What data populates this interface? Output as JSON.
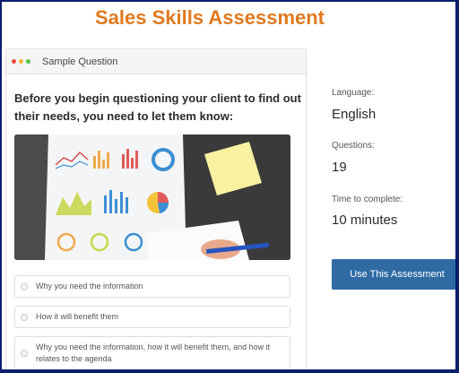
{
  "page": {
    "title": "Sales Skills Assessment"
  },
  "card": {
    "header_label": "Sample Question",
    "window_dot_colors": [
      "#e8493f",
      "#f2b53b",
      "#57c24a"
    ],
    "question": "Before you begin questioning your client to find out their needs, you need to let them know:",
    "image_description_icon": "report-charts-photo",
    "options": [
      {
        "label": "Why you need the information"
      },
      {
        "label": "How it will benefit them"
      },
      {
        "label": "Why you need the information, how it will benefit them, and how it relates to the agenda"
      }
    ]
  },
  "info": {
    "language_label": "Language:",
    "language_value": "English",
    "questions_label": "Questions:",
    "questions_value": "19",
    "time_label": "Time to complete:",
    "time_value": "10 minutes"
  },
  "cta": {
    "label": "Use This Assessment"
  },
  "colors": {
    "title": "#e07a1f",
    "button": "#2f6aa3",
    "border": "#0b1f6b"
  }
}
